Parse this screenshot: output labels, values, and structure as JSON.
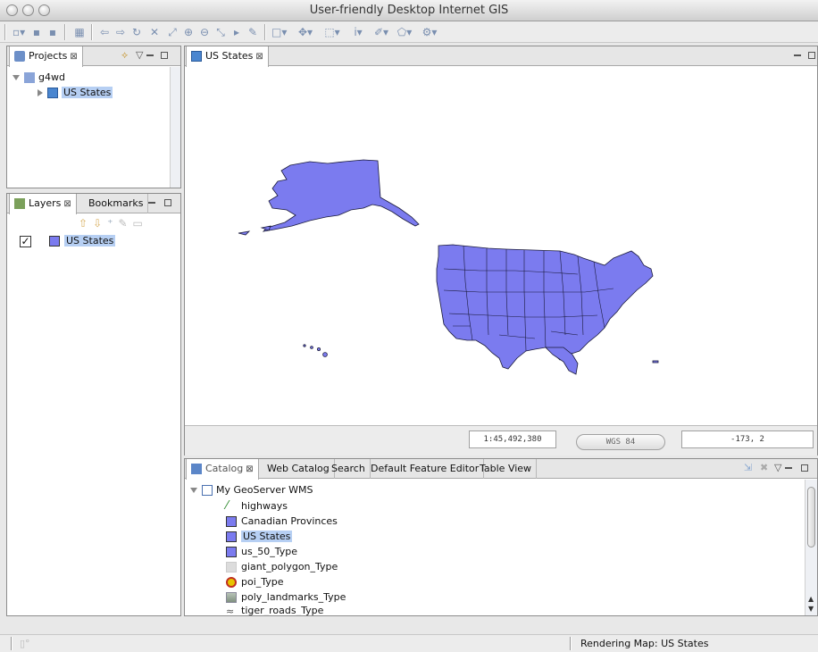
{
  "window": {
    "title": "User-friendly Desktop Internet GIS"
  },
  "toolbar": {
    "icons": [
      "new-icon",
      "save-icon",
      "save-all-icon",
      "properties-icon",
      "back-icon",
      "forward-icon",
      "refresh-icon",
      "stop-icon",
      "zoom-extent-icon",
      "zoom-in-icon",
      "zoom-out-icon",
      "pan-icon",
      "select-icon",
      "edit-icon",
      "color-icon",
      "navigate-icon",
      "box-select-icon",
      "info-icon",
      "draw-icon",
      "feature-icon",
      "tool-icon"
    ]
  },
  "projects": {
    "tab": "Projects",
    "tree": [
      {
        "label": "g4wd",
        "expanded": true
      },
      {
        "label": "US States",
        "selected": true
      }
    ]
  },
  "layers": {
    "tabs": [
      "Layers",
      "Bookmarks"
    ],
    "items": [
      {
        "label": "US States",
        "checked": true,
        "color": "#7b7bef"
      }
    ]
  },
  "map": {
    "tab": "US States",
    "fill_color": "#7b7bef",
    "scale": "1:45,492,380",
    "crs": "WGS 84",
    "coords": "-173, 2"
  },
  "catalog": {
    "tabs": [
      "Catalog",
      "Web Catalog",
      "Search",
      "Default Feature Editor",
      "Table View"
    ],
    "root": "My GeoServer WMS",
    "items": [
      {
        "label": "highways",
        "icon": "line-icon",
        "color": "#2f8a2f"
      },
      {
        "label": "Canadian Provinces",
        "icon": "polygon-icon",
        "color": "#7b7bef"
      },
      {
        "label": "US States",
        "icon": "polygon-icon",
        "color": "#7b7bef",
        "selected": true
      },
      {
        "label": "us_50_Type",
        "icon": "polygon-icon",
        "color": "#7b7bef"
      },
      {
        "label": "giant_polygon_Type",
        "icon": "polygon-icon",
        "color": "#dcdcdc"
      },
      {
        "label": "poi_Type",
        "icon": "point-icon",
        "color": "#e8c400"
      },
      {
        "label": "poly_landmarks_Type",
        "icon": "landmark-icon",
        "color": "#9aa89a"
      },
      {
        "label": "tiger_roads_Type",
        "icon": "road-icon",
        "color": "#555555"
      }
    ]
  },
  "status": {
    "message": "Rendering Map: US States"
  }
}
